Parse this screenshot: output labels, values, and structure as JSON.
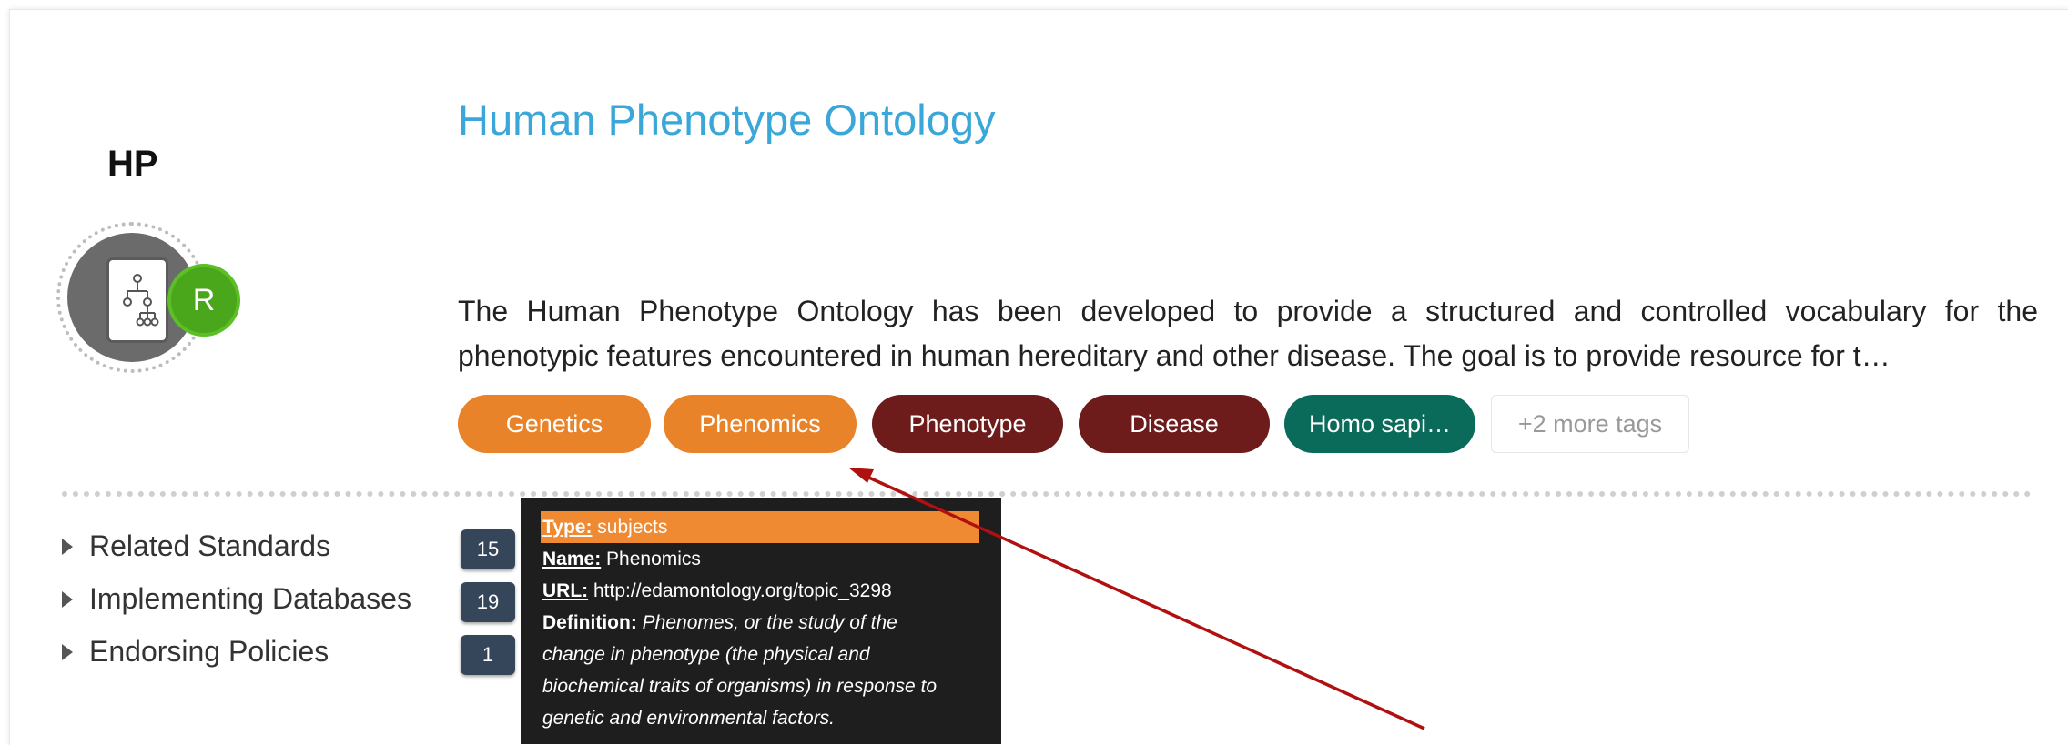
{
  "record": {
    "abbreviation": "HP",
    "badge_letter": "R",
    "title": "Human Phenotype Ontology",
    "description_line1": "The Human Phenotype Ontology has been developed to provide a structured and controlled vocabulary for the",
    "description_line2": "phenotypic features encountered in human hereditary and other disease. The goal is to provide resource for t…"
  },
  "tags": [
    {
      "label": "Genetics",
      "color": "#e8832a"
    },
    {
      "label": "Phenomics",
      "color": "#e8832a"
    },
    {
      "label": "Phenotype",
      "color": "#6e1b1b"
    },
    {
      "label": "Disease",
      "color": "#6e1b1b"
    },
    {
      "label": "Homo sapi…",
      "color": "#0b6b5a"
    },
    {
      "label": "+2 more tags",
      "color": "#ffffff"
    }
  ],
  "relations": [
    {
      "label": "Related Standards",
      "count": "15"
    },
    {
      "label": "Implementing Databases",
      "count": "19"
    },
    {
      "label": "Endorsing Policies",
      "count": "1"
    }
  ],
  "tooltip": {
    "type_key": "Type:",
    "type_value": "subjects",
    "name_key": "Name:",
    "name_value": "Phenomics",
    "url_key": "URL:",
    "url_value": "http://edamontology.org/topic_3298",
    "definition_key": "Definition:",
    "definition_line1": "Phenomes, or the study of the",
    "definition_line2": "change in phenotype (the physical and",
    "definition_line3": "biochemical traits of organisms) in response to",
    "definition_line4": "genetic and environmental factors."
  },
  "colors": {
    "title": "#3aa7d8",
    "annotation_arrow": "#b01010",
    "tooltip_type_highlight": "#ef8a32",
    "count_badge": "#36465a"
  }
}
